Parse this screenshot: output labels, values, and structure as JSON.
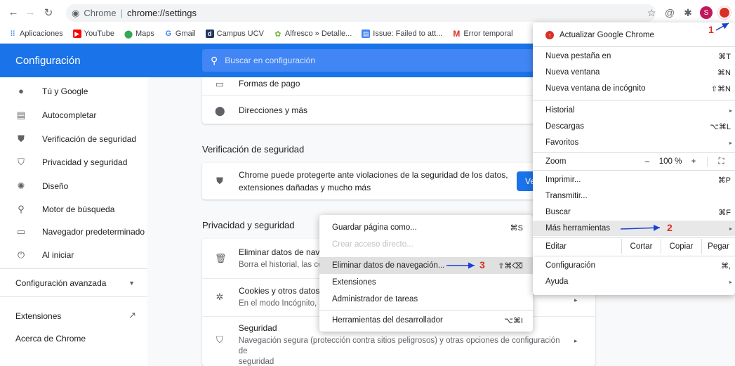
{
  "browser": {
    "omnibox_label": "Chrome",
    "omnibox_sep": "|",
    "omnibox_url": "chrome://settings",
    "avatar_letter": "S"
  },
  "bookmarks": [
    {
      "label": "Aplicaciones",
      "icon": "apps-grid-icon"
    },
    {
      "label": "YouTube",
      "icon": "youtube-icon"
    },
    {
      "label": "Maps",
      "icon": "maps-pin-icon"
    },
    {
      "label": "Gmail",
      "icon": "google-icon"
    },
    {
      "label": "Campus UCV",
      "icon": "campus-icon"
    },
    {
      "label": "Alfresco » Detalle...",
      "icon": "alfresco-icon"
    },
    {
      "label": "Issue: Failed to att...",
      "icon": "issue-icon"
    },
    {
      "label": "Error temporal",
      "icon": "gmail-icon"
    }
  ],
  "header": {
    "title": "Configuración",
    "search_placeholder": "Buscar en configuración"
  },
  "sidebar": {
    "items": [
      {
        "label": "Tú y Google",
        "icon": "person-icon"
      },
      {
        "label": "Autocompletar",
        "icon": "clipboard-icon"
      },
      {
        "label": "Verificación de seguridad",
        "icon": "shield-check-icon"
      },
      {
        "label": "Privacidad y seguridad",
        "icon": "shield-icon"
      },
      {
        "label": "Diseño",
        "icon": "palette-icon"
      },
      {
        "label": "Motor de búsqueda",
        "icon": "search-icon"
      },
      {
        "label": "Navegador predeterminado",
        "icon": "browser-icon"
      },
      {
        "label": "Al iniciar",
        "icon": "power-icon"
      }
    ],
    "advanced": "Configuración avanzada",
    "extensions": "Extensiones",
    "about": "Acerca de Chrome"
  },
  "main": {
    "autofill_rows": [
      {
        "title": "Formas de pago",
        "icon": "credit-card-icon"
      },
      {
        "title": "Direcciones y más",
        "icon": "location-pin-icon"
      }
    ],
    "safety_title": "Verificación de seguridad",
    "safety_text_1": "Chrome puede protegerte ante violaciones de la seguridad de los datos,",
    "safety_text_2": "extensiones dañadas y mucho más",
    "safety_button": "Ve",
    "privacy_title": "Privacidad y seguridad",
    "privacy_rows": [
      {
        "title": "Eliminar datos de navega",
        "sub": "Borra el historial, las cook"
      },
      {
        "title": "Cookies y otros datos de",
        "sub": "En el modo Incógnito, se"
      },
      {
        "title": "Seguridad",
        "sub": "Navegación segura (protección contra sitios peligrosos) y otras opciones de configuración de",
        "sub2": "seguridad"
      }
    ]
  },
  "menu": {
    "update": "Actualizar Google Chrome",
    "items1": [
      {
        "label": "Nueva pestaña en",
        "shortcut": "⌘T"
      },
      {
        "label": "Nueva ventana",
        "shortcut": "⌘N"
      },
      {
        "label": "Nueva ventana de incógnito",
        "shortcut": "⇧⌘N"
      }
    ],
    "items2": [
      {
        "label": "Historial",
        "shortcut": "▸"
      },
      {
        "label": "Descargas",
        "shortcut": "⌥⌘L"
      },
      {
        "label": "Favoritos",
        "shortcut": "▸"
      }
    ],
    "zoom_label": "Zoom",
    "zoom_minus": "–",
    "zoom_value": "100 %",
    "zoom_plus": "+",
    "zoom_full": "⛶",
    "items3": [
      {
        "label": "Imprimir...",
        "shortcut": "⌘P"
      },
      {
        "label": "Transmitir...",
        "shortcut": ""
      },
      {
        "label": "Buscar",
        "shortcut": "⌘F"
      },
      {
        "label": "Más herramientas",
        "shortcut": "▸"
      }
    ],
    "edit_label": "Editar",
    "edit_cut": "Cortar",
    "edit_copy": "Copiar",
    "edit_paste": "Pegar",
    "settings": "Configuración",
    "settings_shortcut": "⌘,",
    "help": "Ayuda",
    "help_arrow": "▸"
  },
  "submenu": {
    "items": [
      {
        "label": "Guardar página como...",
        "shortcut": "⌘S"
      },
      {
        "label": "Crear acceso directo...",
        "shortcut": ""
      },
      {
        "label": "Eliminar datos de navegación...",
        "shortcut": "⇧⌘⌫"
      },
      {
        "label": "Extensiones",
        "shortcut": ""
      },
      {
        "label": "Administrador de tareas",
        "shortcut": ""
      },
      {
        "label": "Herramientas del desarrollador",
        "shortcut": "⌥⌘I"
      }
    ]
  },
  "annotations": {
    "step1": "1",
    "step2": "2",
    "step3": "3",
    "color": "#d93025",
    "arrow_color": "#1a3fd6"
  }
}
